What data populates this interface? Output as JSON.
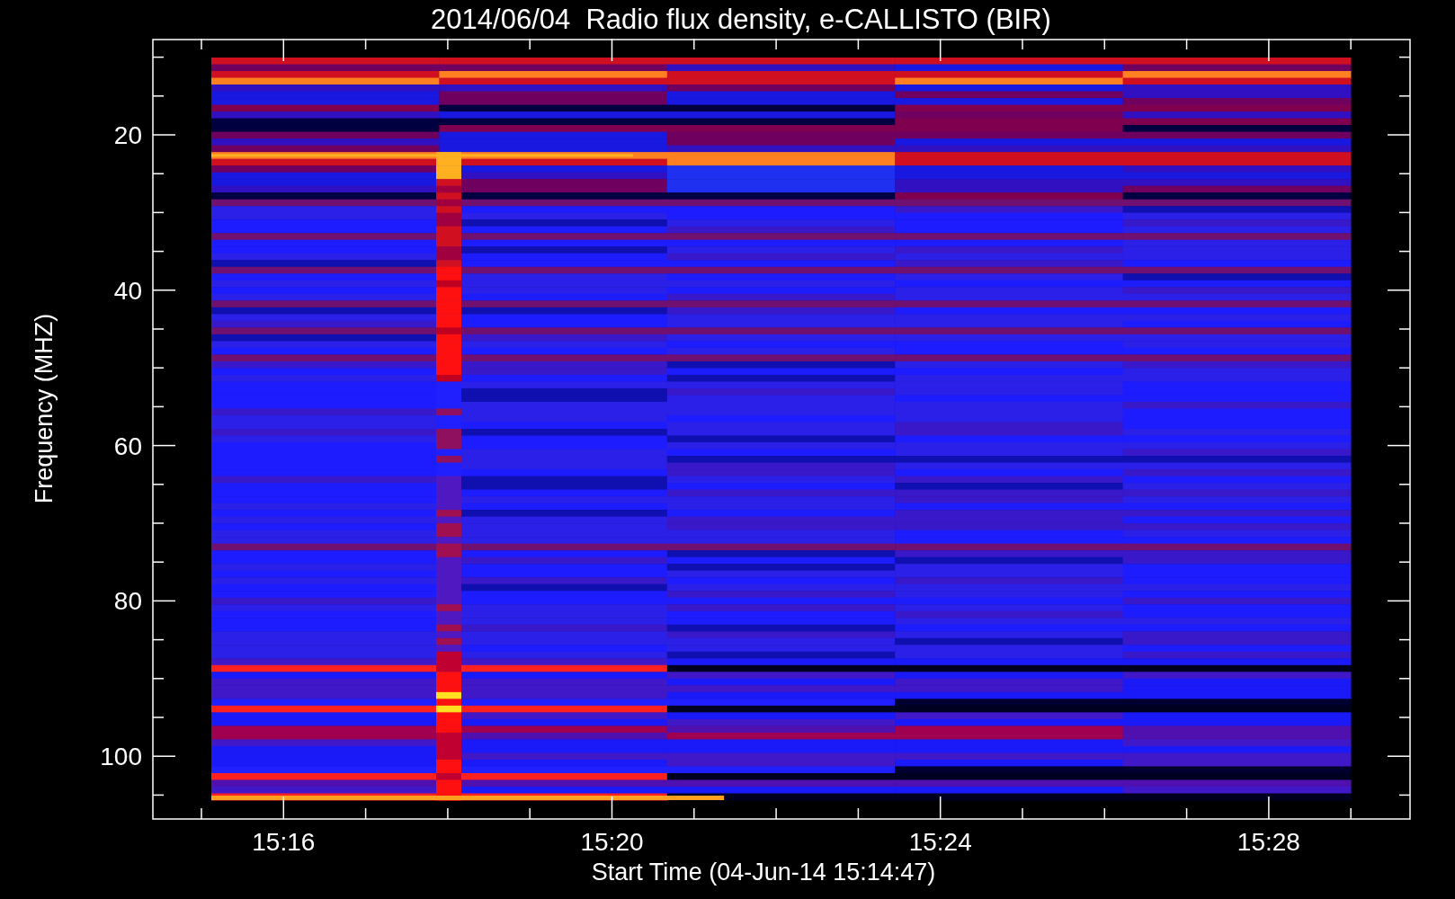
{
  "title": "2014/06/04  Radio flux density, e-CALLISTO (BIR)",
  "y_axis": {
    "label": "Frequency (MHZ)",
    "ticks": [
      "20",
      "40",
      "60",
      "80",
      "100"
    ]
  },
  "x_axis": {
    "label": "Start Time (04-Jun-14 15:14:47)",
    "ticks": [
      "15:16",
      "15:20",
      "15:24",
      "15:28"
    ]
  }
}
